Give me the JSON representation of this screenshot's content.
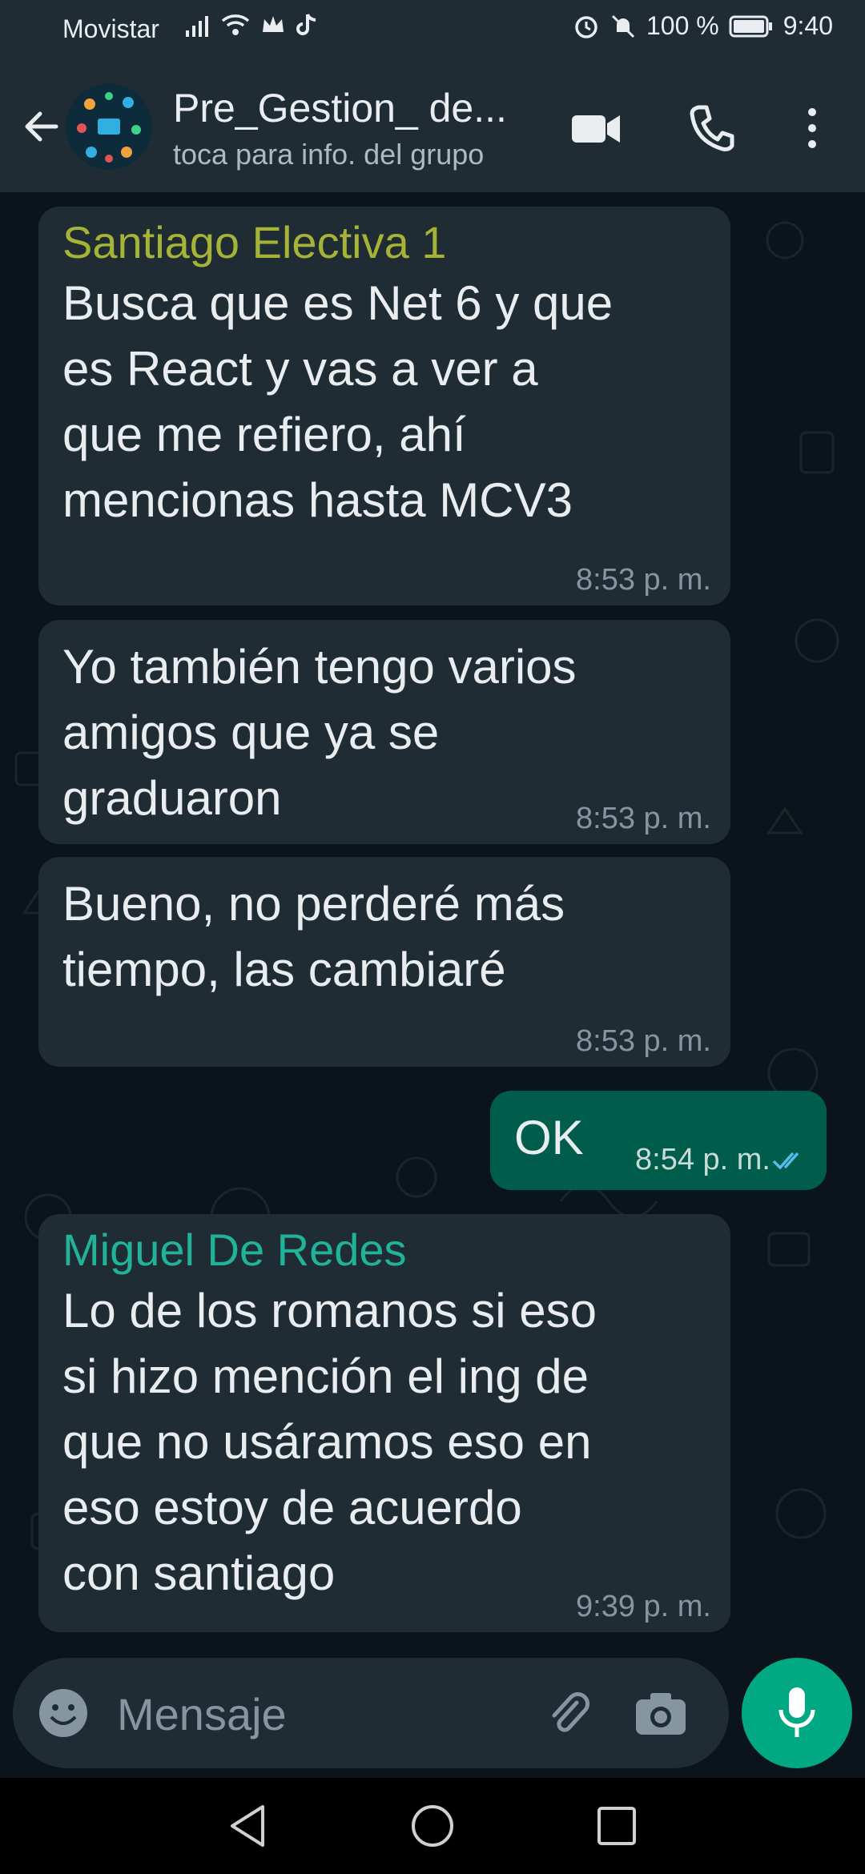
{
  "status_bar": {
    "carrier": "Movistar",
    "battery": "100 %",
    "time": "9:40"
  },
  "header": {
    "title": "Pre_Gestion_ de...",
    "subtitle": "toca para info. del grupo",
    "icons": [
      "back-arrow-icon",
      "group-avatar",
      "video-call-icon",
      "phone-icon",
      "more-options-icon"
    ]
  },
  "messages": [
    {
      "direction": "in",
      "sender": "Santiago Electiva 1",
      "sender_color": "#a5b337",
      "lines": [
        "Busca que es Net 6 y que",
        "es React y vas a ver a",
        "que me refiero, ahí",
        "mencionas hasta MCV3"
      ],
      "time": "8:53 p. m."
    },
    {
      "direction": "in",
      "lines": [
        "Yo también tengo varios",
        "amigos que ya se",
        "graduaron"
      ],
      "time": "8:53 p. m."
    },
    {
      "direction": "in",
      "lines": [
        "Bueno, no perderé más",
        "tiempo, las cambiaré"
      ],
      "time": "8:53 p. m."
    },
    {
      "direction": "out",
      "lines": [
        "OK"
      ],
      "time": "8:54 p. m.",
      "status": "read"
    },
    {
      "direction": "in",
      "sender": "Miguel De Redes",
      "sender_color": "#21b39a",
      "lines": [
        "Lo de los romanos si eso",
        "si hizo mención el ing de",
        "que no usáramos eso en",
        "eso estoy de acuerdo",
        "con santiago"
      ],
      "time": "9:39 p. m."
    }
  ],
  "composer": {
    "placeholder": "Mensaje",
    "icons": [
      "emoji-icon",
      "attach-icon",
      "camera-icon",
      "mic-icon"
    ]
  },
  "colors": {
    "background": "#0b141a",
    "header": "#1f2c34",
    "incoming_bubble": "#202c33",
    "outgoing_bubble": "#005c4b",
    "accent": "#00a884",
    "read_ticks": "#53bdeb"
  }
}
